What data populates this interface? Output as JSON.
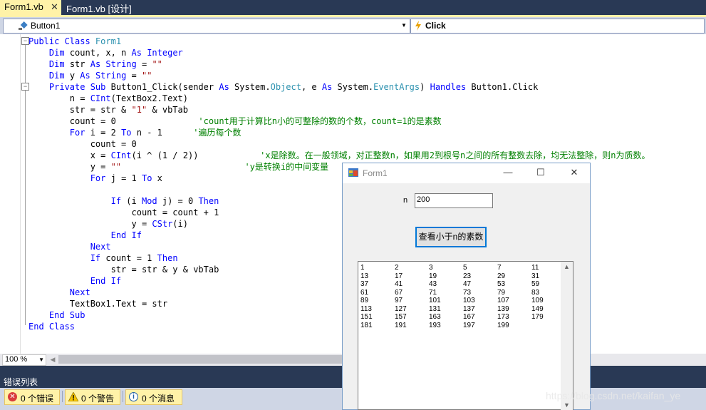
{
  "tabs": [
    {
      "label": "Form1.vb",
      "close": "✕",
      "active": true
    },
    {
      "label": "Form1.vb [设计]",
      "active": false
    }
  ],
  "nav": {
    "object_combo": "Button1",
    "event_combo": "Click"
  },
  "code_lines": [
    [
      {
        "c": "kw",
        "t": "Public Class "
      },
      {
        "c": "ty",
        "t": "Form1"
      }
    ],
    [
      {
        "c": "",
        "t": "    "
      },
      {
        "c": "kw",
        "t": "Dim"
      },
      {
        "c": "",
        "t": " count, x, n "
      },
      {
        "c": "kw",
        "t": "As Integer"
      }
    ],
    [
      {
        "c": "",
        "t": "    "
      },
      {
        "c": "kw",
        "t": "Dim"
      },
      {
        "c": "",
        "t": " str "
      },
      {
        "c": "kw",
        "t": "As String"
      },
      {
        "c": "",
        "t": " = "
      },
      {
        "c": "st",
        "t": "\"\""
      }
    ],
    [
      {
        "c": "",
        "t": "    "
      },
      {
        "c": "kw",
        "t": "Dim"
      },
      {
        "c": "",
        "t": " y "
      },
      {
        "c": "kw",
        "t": "As String"
      },
      {
        "c": "",
        "t": " = "
      },
      {
        "c": "st",
        "t": "\"\""
      }
    ],
    [
      {
        "c": "",
        "t": "    "
      },
      {
        "c": "kw",
        "t": "Private Sub"
      },
      {
        "c": "",
        "t": " Button1_Click(sender "
      },
      {
        "c": "kw",
        "t": "As"
      },
      {
        "c": "",
        "t": " System."
      },
      {
        "c": "ty",
        "t": "Object"
      },
      {
        "c": "",
        "t": ", e "
      },
      {
        "c": "kw",
        "t": "As"
      },
      {
        "c": "",
        "t": " System."
      },
      {
        "c": "ty",
        "t": "EventArgs"
      },
      {
        "c": "",
        "t": ") "
      },
      {
        "c": "kw",
        "t": "Handles"
      },
      {
        "c": "",
        "t": " Button1.Click"
      }
    ],
    [
      {
        "c": "",
        "t": "        n = "
      },
      {
        "c": "kw",
        "t": "CInt"
      },
      {
        "c": "",
        "t": "(TextBox2.Text)"
      }
    ],
    [
      {
        "c": "",
        "t": "        str = str & "
      },
      {
        "c": "st",
        "t": "\"1\""
      },
      {
        "c": "",
        "t": " & vbTab"
      }
    ],
    [
      {
        "c": "",
        "t": "        count = 0                "
      },
      {
        "c": "cm",
        "t": "'count用于计算比n小的可整除的数的个数，count=1的是素数"
      }
    ],
    [
      {
        "c": "",
        "t": "        "
      },
      {
        "c": "kw",
        "t": "For"
      },
      {
        "c": "",
        "t": " i = 2 "
      },
      {
        "c": "kw",
        "t": "To"
      },
      {
        "c": "",
        "t": " n - 1      "
      },
      {
        "c": "cm",
        "t": "'遍历每个数"
      }
    ],
    [
      {
        "c": "",
        "t": "            count = 0"
      }
    ],
    [
      {
        "c": "",
        "t": "            x = "
      },
      {
        "c": "kw",
        "t": "CInt"
      },
      {
        "c": "",
        "t": "(i ^ (1 / 2))            "
      },
      {
        "c": "cm",
        "t": "'x是除数。在一般领域，对正整数n，如果用2到根号n之间的所有整数去除，均无法整除，则n为质数。"
      }
    ],
    [
      {
        "c": "",
        "t": "            y = "
      },
      {
        "c": "st",
        "t": "\"\""
      },
      {
        "c": "",
        "t": "                        "
      },
      {
        "c": "cm",
        "t": "'y是转换i的中间变量"
      }
    ],
    [
      {
        "c": "",
        "t": "            "
      },
      {
        "c": "kw",
        "t": "For"
      },
      {
        "c": "",
        "t": " j = 1 "
      },
      {
        "c": "kw",
        "t": "To"
      },
      {
        "c": "",
        "t": " x"
      }
    ],
    [
      {
        "c": "",
        "t": ""
      }
    ],
    [
      {
        "c": "",
        "t": "                "
      },
      {
        "c": "kw",
        "t": "If"
      },
      {
        "c": "",
        "t": " (i "
      },
      {
        "c": "kw",
        "t": "Mod"
      },
      {
        "c": "",
        "t": " j) = 0 "
      },
      {
        "c": "kw",
        "t": "Then"
      }
    ],
    [
      {
        "c": "",
        "t": "                    count = count + 1"
      }
    ],
    [
      {
        "c": "",
        "t": "                    y = "
      },
      {
        "c": "kw",
        "t": "CStr"
      },
      {
        "c": "",
        "t": "(i)"
      }
    ],
    [
      {
        "c": "",
        "t": "                "
      },
      {
        "c": "kw",
        "t": "End If"
      }
    ],
    [
      {
        "c": "",
        "t": "            "
      },
      {
        "c": "kw",
        "t": "Next"
      }
    ],
    [
      {
        "c": "",
        "t": "            "
      },
      {
        "c": "kw",
        "t": "If"
      },
      {
        "c": "",
        "t": " count = 1 "
      },
      {
        "c": "kw",
        "t": "Then"
      }
    ],
    [
      {
        "c": "",
        "t": "                str = str & y & vbTab"
      }
    ],
    [
      {
        "c": "",
        "t": "            "
      },
      {
        "c": "kw",
        "t": "End If"
      }
    ],
    [
      {
        "c": "",
        "t": "        "
      },
      {
        "c": "kw",
        "t": "Next"
      }
    ],
    [
      {
        "c": "",
        "t": "        TextBox1.Text = str"
      }
    ],
    [
      {
        "c": "",
        "t": "    "
      },
      {
        "c": "kw",
        "t": "End Sub"
      }
    ],
    [
      {
        "c": "kw",
        "t": "End Class"
      }
    ]
  ],
  "zoom": "100 %",
  "error_list": {
    "title": "错误列表",
    "errors": "0 个错误",
    "warnings": "0 个警告",
    "messages": "0 个消息"
  },
  "form": {
    "title": "Form1",
    "n_label": "n",
    "n_value": "200",
    "button_label": "查看小于n的素数",
    "primes": [
      [
        "1",
        "2",
        "3",
        "5",
        "7",
        "11"
      ],
      [
        "13",
        "17",
        "19",
        "23",
        "29",
        "31"
      ],
      [
        "37",
        "41",
        "43",
        "47",
        "53",
        "59"
      ],
      [
        "61",
        "67",
        "71",
        "73",
        "79",
        "83"
      ],
      [
        "89",
        "97",
        "101",
        "103",
        "107",
        "109"
      ],
      [
        "113",
        "127",
        "131",
        "137",
        "139",
        "149"
      ],
      [
        "151",
        "157",
        "163",
        "167",
        "173",
        "179"
      ],
      [
        "181",
        "191",
        "193",
        "197",
        "199"
      ]
    ]
  },
  "watermark": "https://blog.csdn.net/kaifan_ye",
  "colors": {
    "ide_frame": "#293955",
    "active_tab": "#fff2a8",
    "keyword": "#0000ff",
    "type": "#2b91af",
    "string": "#a31515",
    "comment": "#008000",
    "focus_border": "#0078d7"
  }
}
